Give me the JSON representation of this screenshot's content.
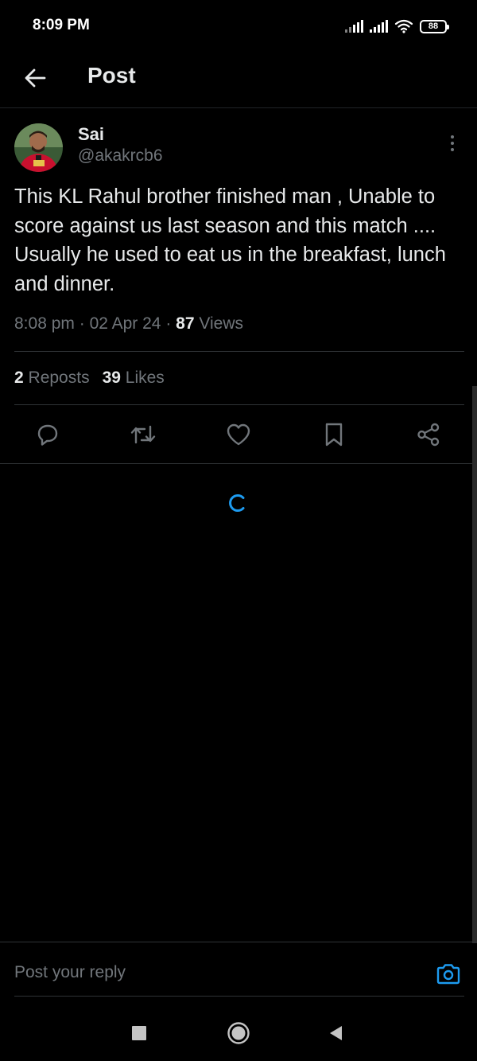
{
  "status_bar": {
    "time": "8:09 PM",
    "battery": "88",
    "icons": [
      "signal-icon",
      "signal-icon",
      "wifi-icon",
      "battery-icon"
    ]
  },
  "header": {
    "title": "Post",
    "back_icon": "back-arrow-icon"
  },
  "post": {
    "author_name": "Sai",
    "author_handle": "@akakrcb6",
    "text": "This KL Rahul brother finished man , Unable to score against us last season and this match .... Usually he used to eat us in the breakfast, lunch and dinner.",
    "time": "8:08 pm",
    "date": "02 Apr 24",
    "views_count": "87",
    "views_label": "Views",
    "separator": "·",
    "reposts_count": "2",
    "reposts_label": "Reposts",
    "likes_count": "39",
    "likes_label": "Likes"
  },
  "actions": [
    "reply-icon",
    "repost-icon",
    "like-icon",
    "bookmark-icon",
    "share-icon"
  ],
  "reply": {
    "placeholder": "Post your reply",
    "camera_icon": "camera-icon"
  },
  "nav": [
    "recents-icon",
    "home-icon",
    "back-icon"
  ],
  "colors": {
    "background": "#000000",
    "text_primary": "#e7e9ea",
    "text_secondary": "#71767b",
    "divider": "#2f3336",
    "accent": "#1d9bf0"
  }
}
